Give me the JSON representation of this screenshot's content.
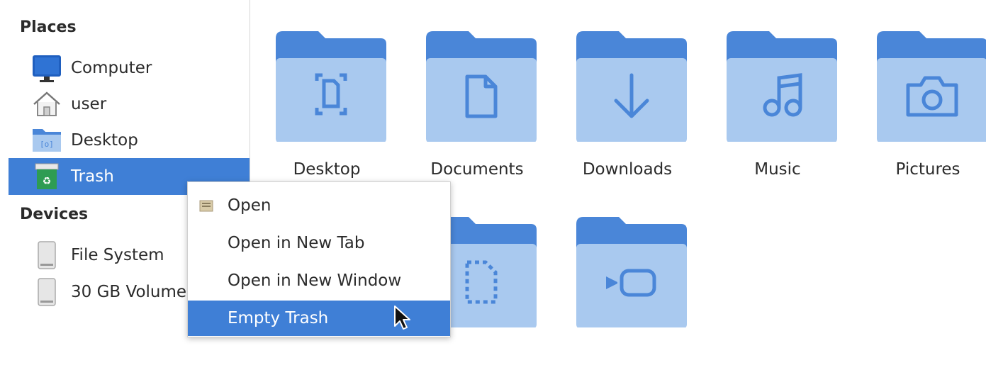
{
  "sidebar": {
    "places_title": "Places",
    "places": [
      {
        "label": "Computer",
        "icon": "monitor-icon"
      },
      {
        "label": "user",
        "icon": "home-icon"
      },
      {
        "label": "Desktop",
        "icon": "desktop-folder-icon"
      },
      {
        "label": "Trash",
        "icon": "trash-icon",
        "selected": true
      }
    ],
    "devices_title": "Devices",
    "devices": [
      {
        "label": "File System",
        "icon": "drive-icon"
      },
      {
        "label": "30 GB Volume",
        "icon": "drive-icon"
      }
    ]
  },
  "folders": [
    {
      "label": "Desktop",
      "icon": "desktop-folder-icon"
    },
    {
      "label": "Documents",
      "icon": "documents-folder-icon"
    },
    {
      "label": "Downloads",
      "icon": "downloads-folder-icon"
    },
    {
      "label": "Music",
      "icon": "music-folder-icon"
    },
    {
      "label": "Pictures",
      "icon": "pictures-folder-icon"
    },
    {
      "label": "",
      "icon": "templates-folder-icon"
    },
    {
      "label": "",
      "icon": "videos-folder-icon"
    }
  ],
  "context_menu": {
    "items": [
      {
        "label": "Open",
        "icon": "open-icon"
      },
      {
        "label": "Open in New Tab"
      },
      {
        "label": "Open in New Window"
      },
      {
        "label": "Empty Trash",
        "active": true
      }
    ]
  },
  "colors": {
    "accent": "#3f7fd6",
    "folder_back": "#4a86d8",
    "folder_front": "#a9c9ef",
    "folder_glyph": "#4a86d8"
  }
}
